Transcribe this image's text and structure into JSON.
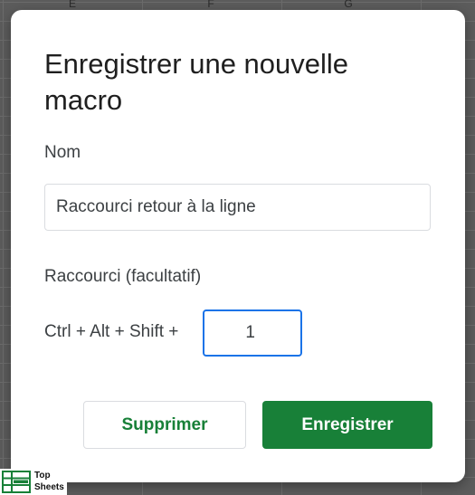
{
  "background": {
    "columns": [
      "E",
      "F",
      "G"
    ]
  },
  "dialog": {
    "title": "Enregistrer une nouvelle macro",
    "name_label": "Nom",
    "name_value": "Raccourci retour à la ligne",
    "shortcut_label": "Raccourci (facultatif)",
    "shortcut_prefix": "Ctrl + Alt + Shift +",
    "shortcut_value": "1",
    "delete_label": "Supprimer",
    "save_label": "Enregistrer"
  },
  "watermark": {
    "line1": "Top",
    "line2": "Sheets"
  },
  "colors": {
    "accent_green": "#188038",
    "focus_blue": "#1a73e8"
  }
}
